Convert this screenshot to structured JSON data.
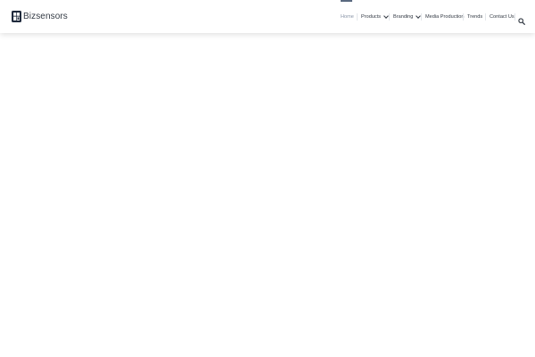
{
  "brand": {
    "name": "Bizsensors"
  },
  "nav": {
    "items": [
      {
        "label": "Home",
        "active": true,
        "has_dropdown": false
      },
      {
        "label": "Products",
        "active": false,
        "has_dropdown": true
      },
      {
        "label": "Branding",
        "active": false,
        "has_dropdown": true
      },
      {
        "label": "Media Production",
        "active": false,
        "has_dropdown": false
      },
      {
        "label": "Trends",
        "active": false,
        "has_dropdown": false
      },
      {
        "label": "Contact Us",
        "active": false,
        "has_dropdown": false
      }
    ],
    "search_icon": "search-icon"
  },
  "colors": {
    "text": "#333a44",
    "active_text": "#8a96a8",
    "accent": "#5a6a80",
    "logo": "#1f2a3c"
  }
}
